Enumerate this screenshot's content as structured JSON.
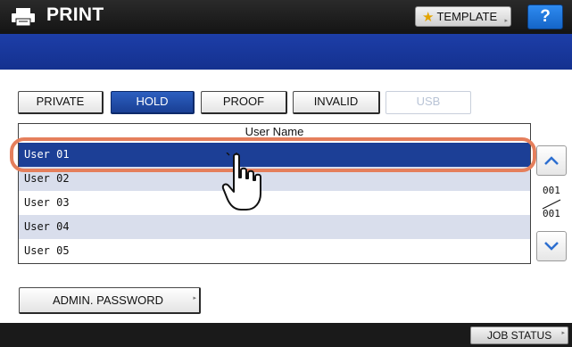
{
  "header": {
    "title": "PRINT",
    "template_label": "TEMPLATE",
    "help_label": "?"
  },
  "tabs": [
    {
      "label": "PRIVATE",
      "state": "normal"
    },
    {
      "label": "HOLD",
      "state": "active"
    },
    {
      "label": "PROOF",
      "state": "normal"
    },
    {
      "label": "INVALID",
      "state": "normal"
    },
    {
      "label": "USB",
      "state": "disabled"
    }
  ],
  "list": {
    "column_header": "User Name",
    "rows": [
      "User 01",
      "User 02",
      "User 03",
      "User 04",
      "User 05"
    ],
    "selected_index": 0
  },
  "pager": {
    "current": "001",
    "total": "001"
  },
  "admin_password_label": "ADMIN. PASSWORD",
  "job_status_label": "JOB STATUS",
  "colors": {
    "accent_blue": "#1c3f96",
    "highlight": "#e57f5c"
  }
}
